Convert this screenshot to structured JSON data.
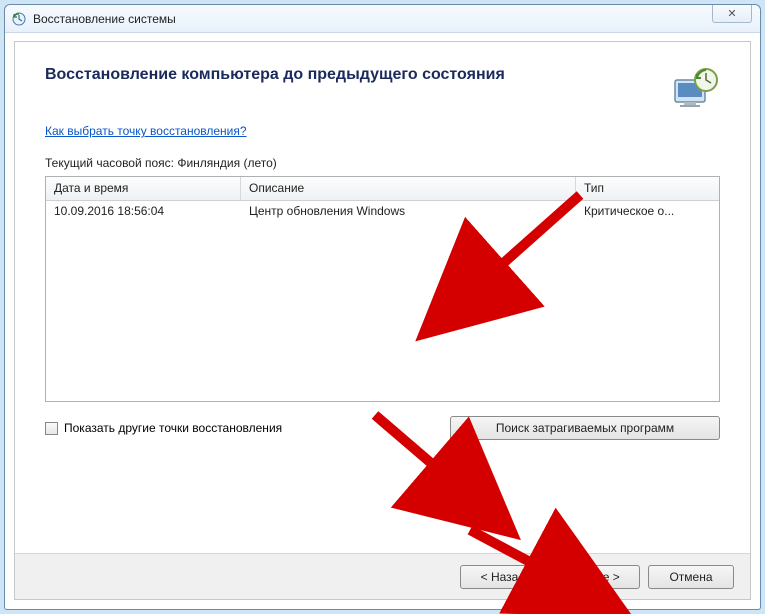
{
  "window": {
    "title": "Восстановление системы",
    "close_glyph": "✕"
  },
  "header": {
    "title": "Восстановление компьютера до предыдущего состояния"
  },
  "help_link": "Как выбрать точку восстановления?",
  "timezone_label": "Текущий часовой пояс: Финляндия (лето)",
  "table": {
    "columns": {
      "datetime": "Дата и время",
      "description": "Описание",
      "type": "Тип"
    },
    "rows": [
      {
        "datetime": "10.09.2016 18:56:04",
        "description": "Центр обновления Windows",
        "type": "Критическое о..."
      }
    ]
  },
  "checkbox_label": "Показать другие точки восстановления",
  "scan_button": "Поиск затрагиваемых программ",
  "footer": {
    "back": "< Назад",
    "next": "Далее >",
    "cancel": "Отмена"
  }
}
